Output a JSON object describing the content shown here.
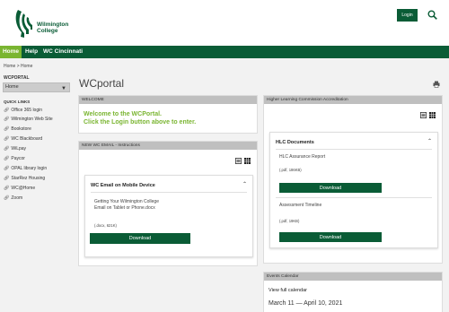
{
  "header": {
    "logo_line1": "Wilmington",
    "logo_line2": "College",
    "login_label": "Login",
    "brand_color": "#0a5c36",
    "accent_color": "#7ab531"
  },
  "nav": {
    "items": [
      {
        "label": "Home",
        "active": true
      },
      {
        "label": "Help"
      },
      {
        "label": "WC Cincinnati"
      }
    ]
  },
  "breadcrumb": "Home > Home",
  "sidebar": {
    "section_title": "WCPORTAL",
    "selected": "Home",
    "quicklinks_title": "QUICK LINKS",
    "links": [
      "Office 365 login",
      "Wilmington Web Site",
      "Bookstore",
      "WC Blackboard",
      "WiLpay",
      "Paycor",
      "OPAL library login",
      "StarRez Housing",
      "WC@Home",
      "Zoom"
    ]
  },
  "main": {
    "title": "WCportal",
    "welcome": {
      "header": "WELCOME",
      "line1": "Welcome to the WCPortal.",
      "line2": "Click the Login button above to enter."
    },
    "email": {
      "header": "NEW WC EMAIL - Instructions",
      "card_title": "WC Email on Mobile Device",
      "doc_line1": "Getting Your Wilmington College",
      "doc_line2": "Email on Tablet or Phone.docx",
      "file_meta": "(.docx, 621K)",
      "download_label": "Download"
    },
    "hlc": {
      "header": "Higher Learning Commission Accreditation",
      "card_title": "HLC Documents",
      "doc1_title": "HLC Assurance Report",
      "doc1_meta": "(.pdf, 186KB)",
      "doc2_title": "Assessment Timeline",
      "doc2_meta": "(.pdf, 19KB)",
      "download_label": "Download"
    },
    "events": {
      "header": "Events Calendar",
      "link": "View full calendar",
      "range": "March 11 — April 10, 2021"
    }
  }
}
